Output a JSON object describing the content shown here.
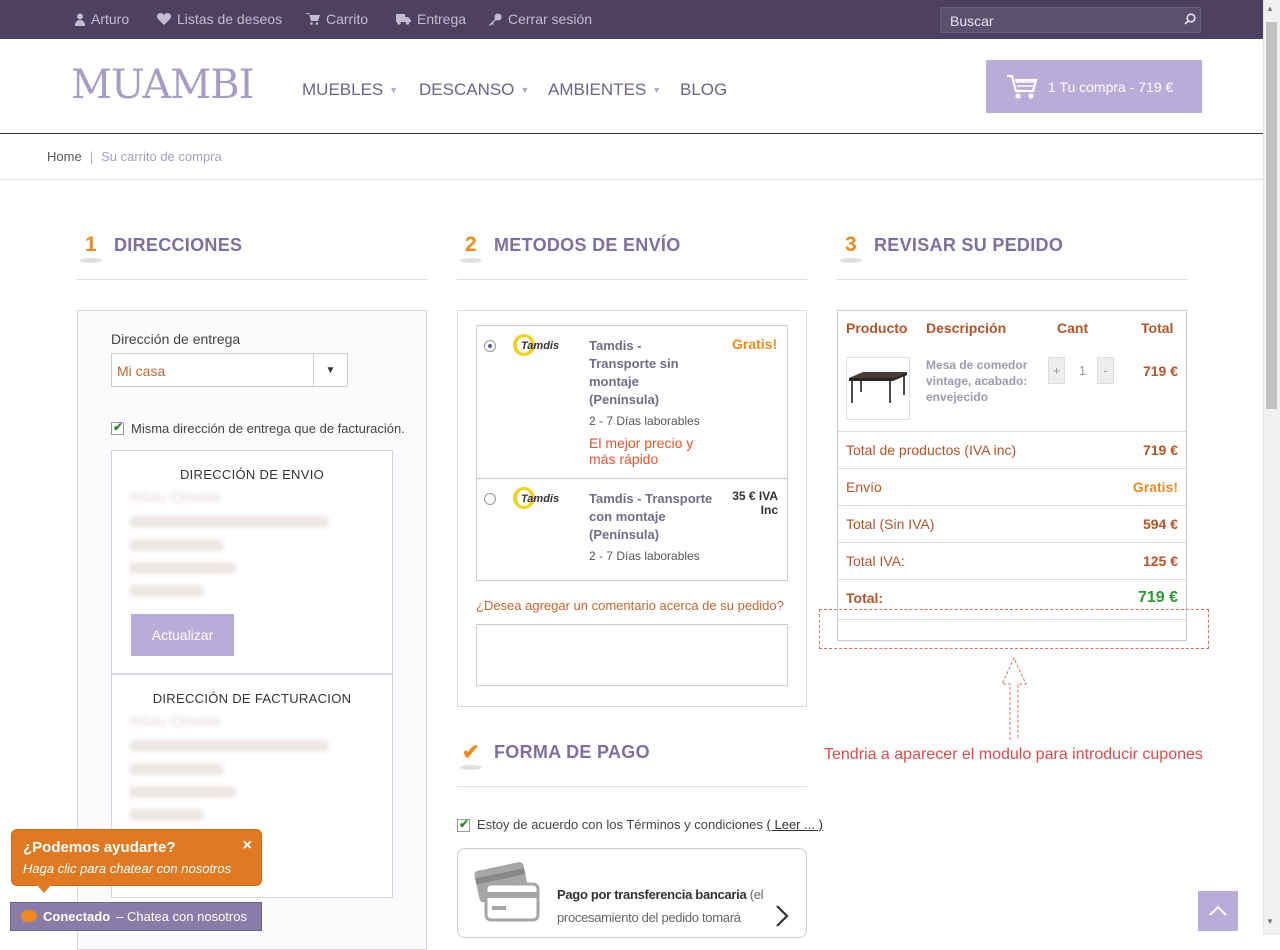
{
  "topbar": {
    "user": "Arturo",
    "wishlist": "Listas de deseos",
    "cart": "Carrito",
    "delivery": "Entrega",
    "logout": "Cerrar sesión",
    "search_placeholder": "Buscar"
  },
  "header": {
    "logo": "MUAMBI",
    "nav": [
      "MUEBLES",
      "DESCANSO",
      "AMBIENTES",
      "BLOG"
    ],
    "cart_button": "1 Tu compra - 719 €"
  },
  "breadcrumb": {
    "home": "Home",
    "separator": "|",
    "current": "Su carrito de compra"
  },
  "addresses": {
    "step": "1",
    "title": "DIRECCIONES",
    "delivery_label": "Dirección de entrega",
    "selected": "Mi casa",
    "same_address_label": "Misma dirección de entrega que de facturación.",
    "same_address_checked": true,
    "shipping_title": "DIRECCIÓN DE ENVIO",
    "shipping_name": "Arturo Olmeda",
    "billing_title": "DIRECCIÓN DE FACTURACION",
    "billing_name": "Arturo Olmeda",
    "update_button": "Actualizar"
  },
  "shipping": {
    "step": "2",
    "title": "METODOS DE ENVÍO",
    "options": [
      {
        "name": "Tamdis - Transporte sin montaje (Península)",
        "days": "2 - 7 Días laborables",
        "price": "Gratis!",
        "promo": "El mejor precio y más rápido",
        "selected": true,
        "logo": "tamdis-logo"
      },
      {
        "name": "Tamdis - Transporte con montaje (Península)",
        "days": "2 - 7 Días laborables",
        "price": "35 € IVA Inc",
        "selected": false,
        "logo": "tamdis-logo"
      }
    ],
    "comment_question": "¿Desea agregar un comentario acerca de su pedido?"
  },
  "payment": {
    "title": "FORMA DE PAGO",
    "terms_label": "Estoy de acuerdo con los Términos y condiciones",
    "terms_link": "( Leer ... )",
    "terms_checked": true,
    "method_bold": "Pago por transferencia bancaria",
    "method_rest": "(el procesamiento del pedido tomará"
  },
  "review": {
    "step": "3",
    "title": "REVISAR SU PEDIDO",
    "headers": {
      "product": "Producto",
      "description": "Descripción",
      "qty": "Cant",
      "total": "Total"
    },
    "item": {
      "description": "Mesa de comedor vintage, acabado: envejecido",
      "qty": "1",
      "total": "719 €",
      "plus": "+",
      "minus": "-"
    },
    "summary": [
      {
        "label": "Total de productos (IVA inc)",
        "value": "719 €"
      },
      {
        "label": "Envío",
        "value": "Gratis!"
      },
      {
        "label": "Total (Sin IVA)",
        "value": "594 €"
      },
      {
        "label": "Total IVA:",
        "value": "125 €"
      },
      {
        "label": "Total:",
        "value": "719 €"
      }
    ]
  },
  "annotation": "Tendria a aparecer el modulo para introducir cupones",
  "chat": {
    "title": "¿Podemos ayudarte?",
    "subtitle": "Haga clic para chatear con nosotros",
    "close": "×",
    "status": "Conectado",
    "status_rest": "– Chatea con nosotros"
  },
  "colors": {
    "topbar": "#4d4060",
    "accent": "#b9acd8",
    "heading": "#7e6ea4",
    "price": "#b5532a",
    "orange": "#f08a1e",
    "green": "#2e9a2e"
  }
}
